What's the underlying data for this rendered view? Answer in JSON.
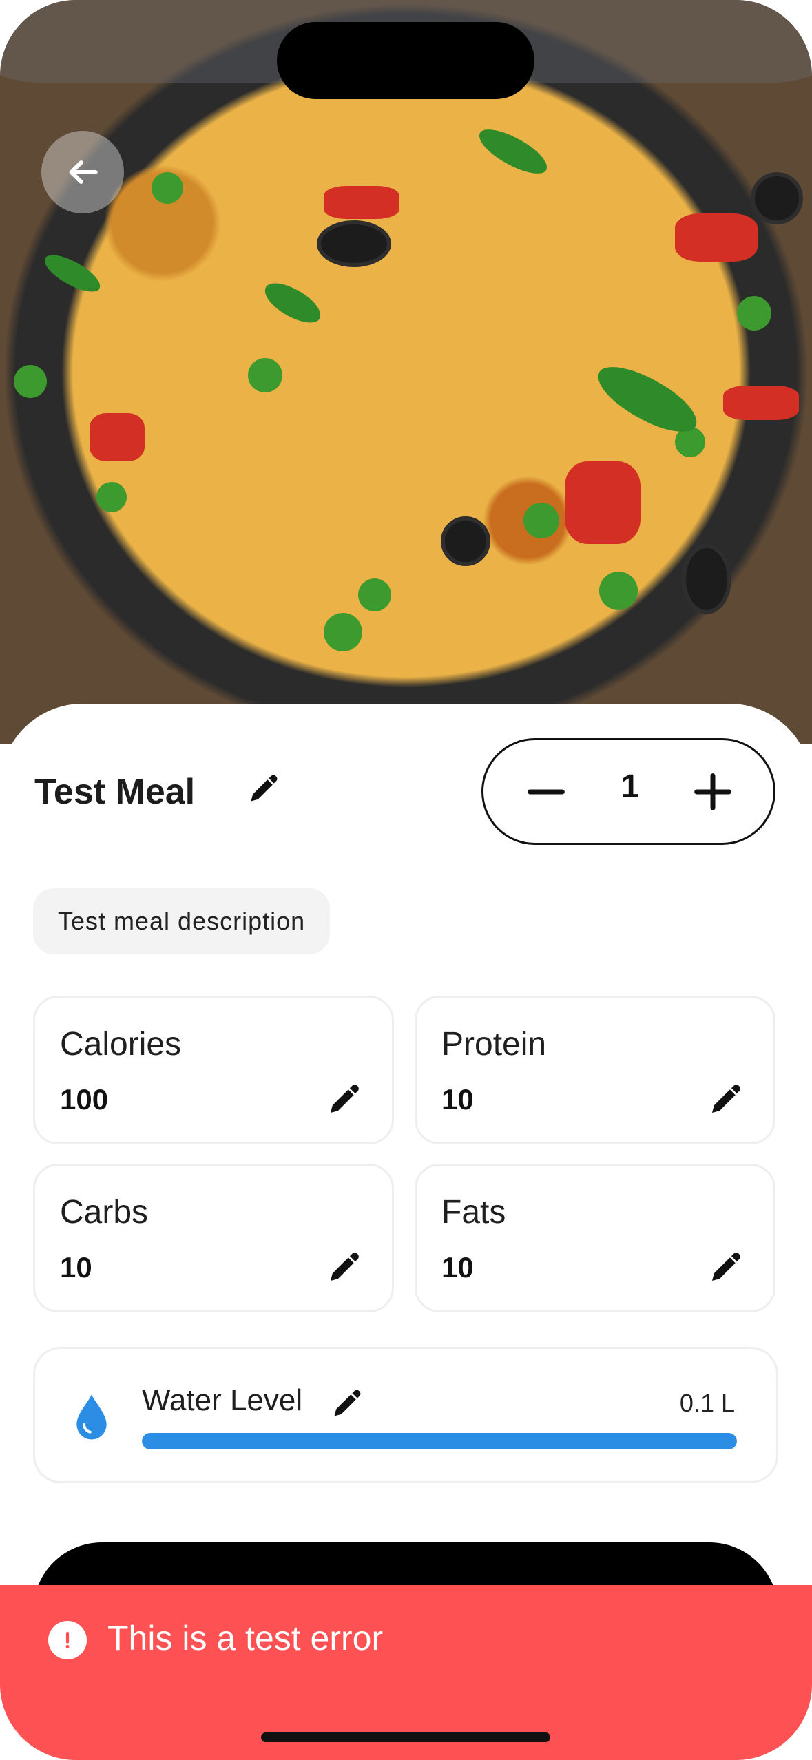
{
  "meal": {
    "title": "Test Meal",
    "description": "Test meal description",
    "quantity": "1"
  },
  "nutrients": [
    {
      "label": "Calories",
      "value": "100"
    },
    {
      "label": "Protein",
      "value": "10"
    },
    {
      "label": "Carbs",
      "value": "10"
    },
    {
      "label": "Fats",
      "value": "10"
    }
  ],
  "water": {
    "label": "Water Level",
    "value": "0.1 L",
    "progress_percent": 100
  },
  "error": {
    "message": "This is a test error"
  },
  "icons": {
    "back": "arrow-left-icon",
    "edit": "pencil-icon",
    "minus": "minus-icon",
    "plus": "plus-icon",
    "water": "water-drop-icon",
    "error": "exclamation-circle-icon"
  },
  "colors": {
    "water_accent": "#2b8de3",
    "error_bg": "#fd5153",
    "primary_button": "#000000"
  }
}
